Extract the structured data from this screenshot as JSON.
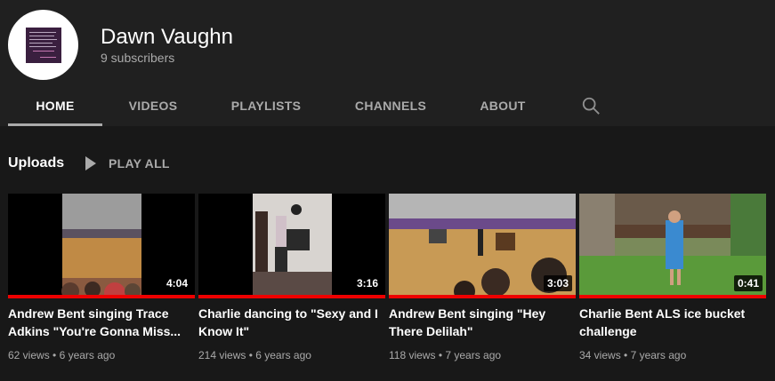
{
  "channel": {
    "name": "Dawn Vaughn",
    "subscribers": "9 subscribers"
  },
  "tabs": [
    {
      "label": "HOME",
      "active": true
    },
    {
      "label": "VIDEOS",
      "active": false
    },
    {
      "label": "PLAYLISTS",
      "active": false
    },
    {
      "label": "CHANNELS",
      "active": false
    },
    {
      "label": "ABOUT",
      "active": false
    }
  ],
  "search_icon": "search-icon",
  "uploads": {
    "title": "Uploads",
    "play_all": "PLAY ALL"
  },
  "videos": [
    {
      "title": "Andrew Bent singing Trace Adkins \"You're Gonna Miss...",
      "views": "62 views",
      "age": "6 years ago",
      "duration": "4:04",
      "watched": 1.0
    },
    {
      "title": "Charlie dancing to \"Sexy and I Know It\"",
      "views": "214 views",
      "age": "6 years ago",
      "duration": "3:16",
      "watched": 1.0
    },
    {
      "title": "Andrew Bent singing \"Hey There Delilah\"",
      "views": "118 views",
      "age": "7 years ago",
      "duration": "3:03",
      "watched": 1.0
    },
    {
      "title": "Charlie Bent ALS ice bucket challenge",
      "views": "34 views",
      "age": "7 years ago",
      "duration": "0:41",
      "watched": 1.0
    }
  ],
  "colors": {
    "background": "#181818",
    "header": "#202020",
    "progress": "#ff0000",
    "muted_text": "#aaaaaa"
  }
}
